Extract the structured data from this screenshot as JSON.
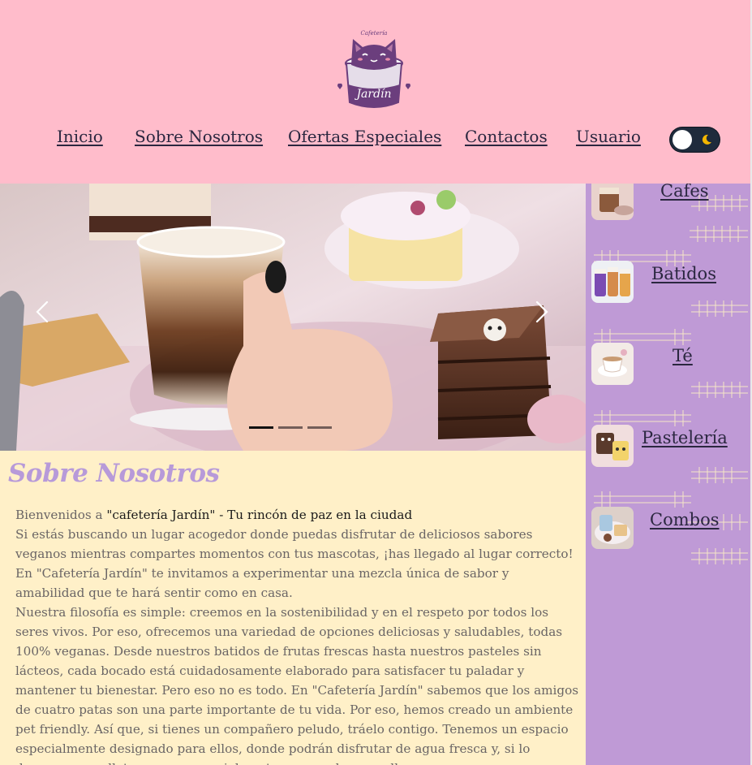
{
  "brand": {
    "top_text": "Cafetería",
    "name": "Jardín"
  },
  "nav": {
    "items": [
      {
        "label": "Inicio"
      },
      {
        "label": "Sobre Nosotros"
      },
      {
        "label": "Ofertas Especiales"
      },
      {
        "label": "Contactos"
      },
      {
        "label": "Usuario"
      }
    ]
  },
  "theme_toggle": {
    "state": "light",
    "icon": "moon-icon"
  },
  "carousel": {
    "slide_count": 3,
    "active_index": 0,
    "prev_icon": "chevron-left-icon",
    "next_icon": "chevron-right-icon"
  },
  "sidebar": {
    "categories": [
      {
        "label": "Cafes"
      },
      {
        "label": "Batidos"
      },
      {
        "label": "Té"
      },
      {
        "label": "Pastelería"
      },
      {
        "label": "Combos"
      }
    ]
  },
  "about": {
    "title": "Sobre Nosotros",
    "intro_prefix": "Bienvenidos a ",
    "intro_highlight": "\"cafetería Jardín\" - Tu rincón de paz en la ciudad",
    "paragraph_1": "Si estás buscando un lugar acogedor donde puedas disfrutar de deliciosos sabores veganos mientras compartes momentos con tus mascotas, ¡has llegado al lugar correcto! En \"Cafetería Jardín\" te invitamos a experimentar una mezcla única de sabor y amabilidad que te hará sentir como en casa.",
    "paragraph_2": "Nuestra filosofía es simple: creemos en la sostenibilidad y en el respeto por todos los seres vivos. Por eso, ofrecemos una variedad de opciones deliciosas y saludables, todas 100% veganas. Desde nuestros batidos de frutas frescas hasta nuestros pasteles sin lácteos, cada bocado está cuidadosamente elaborado para satisfacer tu paladar y mantener tu bienestar. Pero eso no es todo. En \"Cafetería Jardín\" sabemos que los amigos de cuatro patas son una parte importante de tu vida. Por eso, hemos creado un ambiente pet friendly. Así que, si tienes un compañero peludo, tráelo contigo. Tenemos un espacio especialmente designado para ellos, donde podrán disfrutar de agua fresca y, si lo deseas, una galleta vegana especialmente preparada para ellos."
  },
  "colors": {
    "header_bg": "#ffbccb",
    "sidebar_bg": "#bf9ad6",
    "about_bg": "#fff0c8",
    "title_color": "#b79ad9",
    "link_color": "#2b2740",
    "toggle_bg": "#1f2b3c",
    "moon_color": "#f5b700"
  }
}
